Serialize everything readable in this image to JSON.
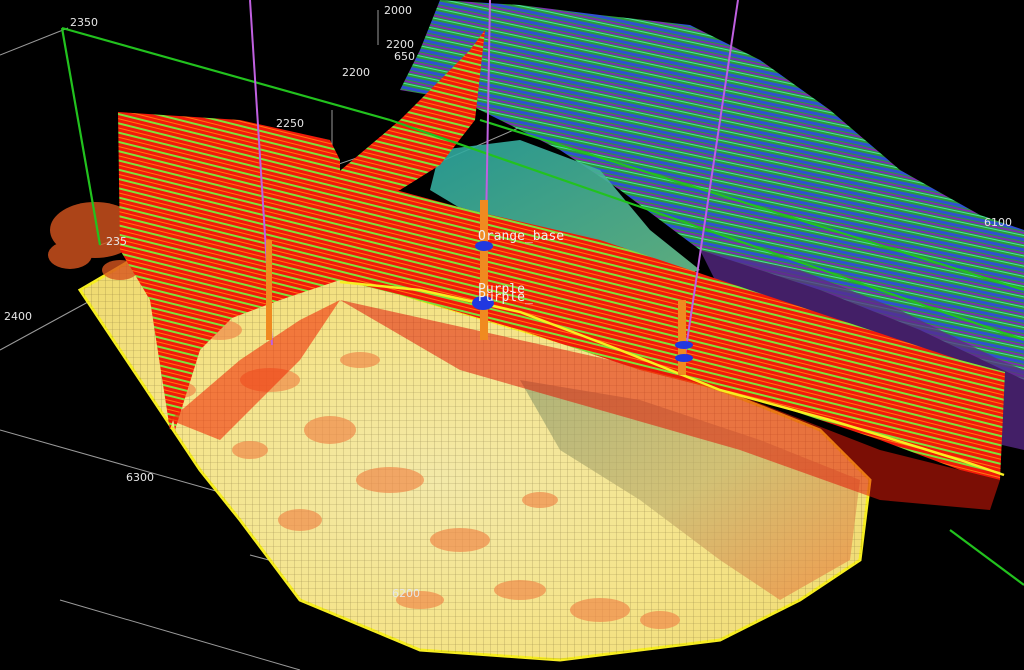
{
  "axis_labels": {
    "z_2000": "2000",
    "z_2200_top": "2200",
    "z_2200_mid": "2200",
    "z_2250": "2250",
    "z_2350_top": "2350",
    "z_2350_left": "235",
    "z_2400": "2400",
    "y_6300": "6300",
    "y_6200": "6200",
    "x_650": "650",
    "x_6100": "6100"
  },
  "horizon_labels": {
    "orange": "Orange_base",
    "purple_1": "Purple",
    "purple_2": "Purple_"
  },
  "colors": {
    "background": "#000000",
    "bounding_box": "#22c21e",
    "grid": "#9a9a9a",
    "well": "#c060e0",
    "horizon_line": "#f7ee21",
    "marker": "#2038e0"
  }
}
